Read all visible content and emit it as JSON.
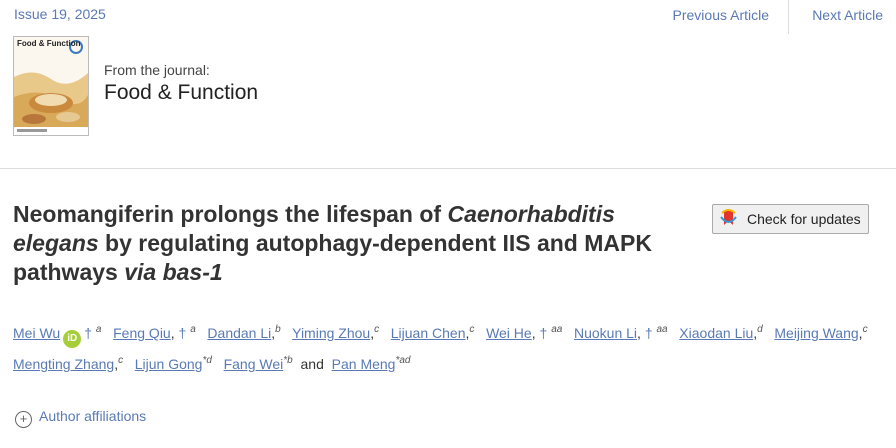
{
  "topbar": {
    "issue": "Issue 19, 2025",
    "previous": "Previous Article",
    "next": "Next Article"
  },
  "journal": {
    "cover_title": "Food & Function",
    "from": "From the journal:",
    "name": "Food & Function"
  },
  "article": {
    "title_1": "Neomangiferin prolongs the lifespan of ",
    "title_2_italic": "Caenorhabditis elegans",
    "title_3": " by regulating autophagy-dependent IIS and MAPK pathways ",
    "title_4_italic": "via bas-1"
  },
  "check_updates": {
    "label": "Check for updates"
  },
  "authors": [
    {
      "name": "Mei Wu",
      "dagger": "†",
      "sup": "a"
    },
    {
      "name": "Feng Qiu",
      "dagger": "†",
      "sup": "a"
    },
    {
      "name": "Dandan Li",
      "sup": "b"
    },
    {
      "name": "Yiming Zhou",
      "sup": "c"
    },
    {
      "name": "Lijuan Chen",
      "sup": "c"
    },
    {
      "name": "Wei He",
      "dagger": "†",
      "sup": "aa"
    },
    {
      "name": "Nuokun Li",
      "dagger": "†",
      "sup": "aa"
    },
    {
      "name": "Xiaodan Liu",
      "sup": "d"
    },
    {
      "name": "Meijing Wang",
      "sup": "c"
    },
    {
      "name": "Mengting Zhang",
      "sup": "c"
    },
    {
      "name": "Lijun Gong",
      "sup": "*d"
    },
    {
      "name": "Fang Wei",
      "sup": "*b"
    },
    {
      "name": "Pan Meng",
      "sup": "*ad"
    }
  ],
  "orcid_label": "iD",
  "and_text": "and",
  "affiliations": {
    "label": "Author affiliations"
  },
  "colors": {
    "link": "#5a7ab5",
    "orcid": "#a6ce39"
  }
}
